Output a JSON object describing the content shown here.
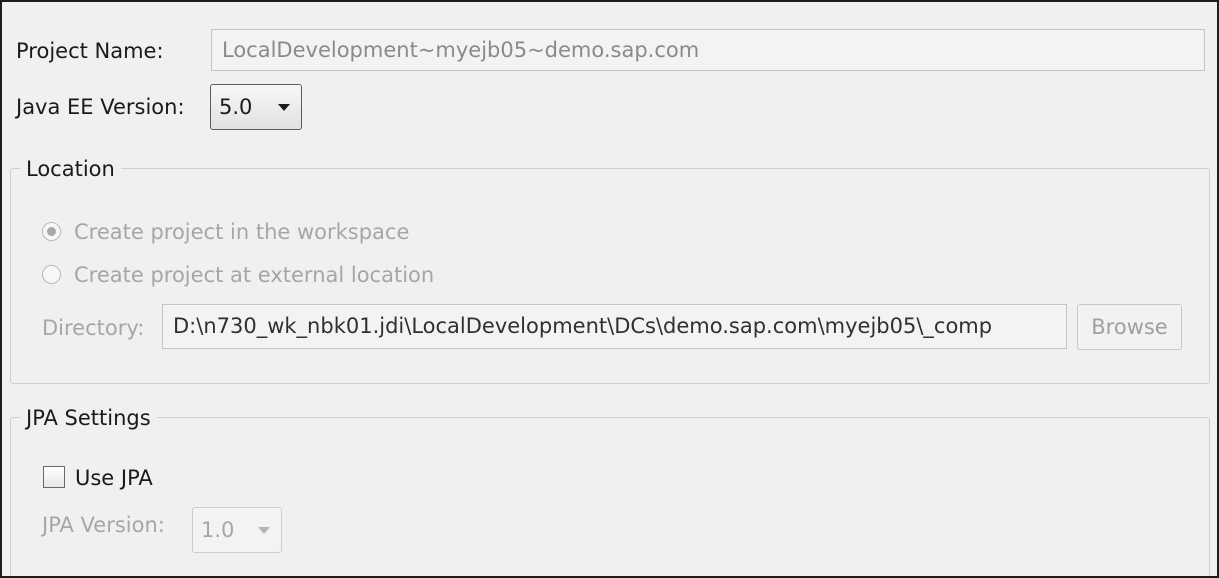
{
  "project": {
    "label": "Project Name:",
    "value": "LocalDevelopment~myejb05~demo.sap.com"
  },
  "javaee": {
    "label": "Java EE Version:",
    "value": "5.0"
  },
  "location": {
    "title": "Location",
    "radio_workspace": "Create project in the workspace",
    "radio_external": "Create project at external location",
    "selected": "workspace",
    "directory_label": "Directory:",
    "directory_value": "D:\\n730_wk_nbk01.jdi\\LocalDevelopment\\DCs\\demo.sap.com\\myejb05\\_comp",
    "browse_label": "Browse"
  },
  "jpa": {
    "title": "JPA Settings",
    "use_jpa_label": "Use JPA",
    "use_jpa_checked": false,
    "version_label": "JPA Version:",
    "version_value": "1.0"
  },
  "icons": {
    "dropdown": "chevron-down-icon",
    "radio_selected": "radio-selected-icon",
    "radio_unselected": "radio-unselected-icon",
    "checkbox": "checkbox-unchecked-icon"
  }
}
